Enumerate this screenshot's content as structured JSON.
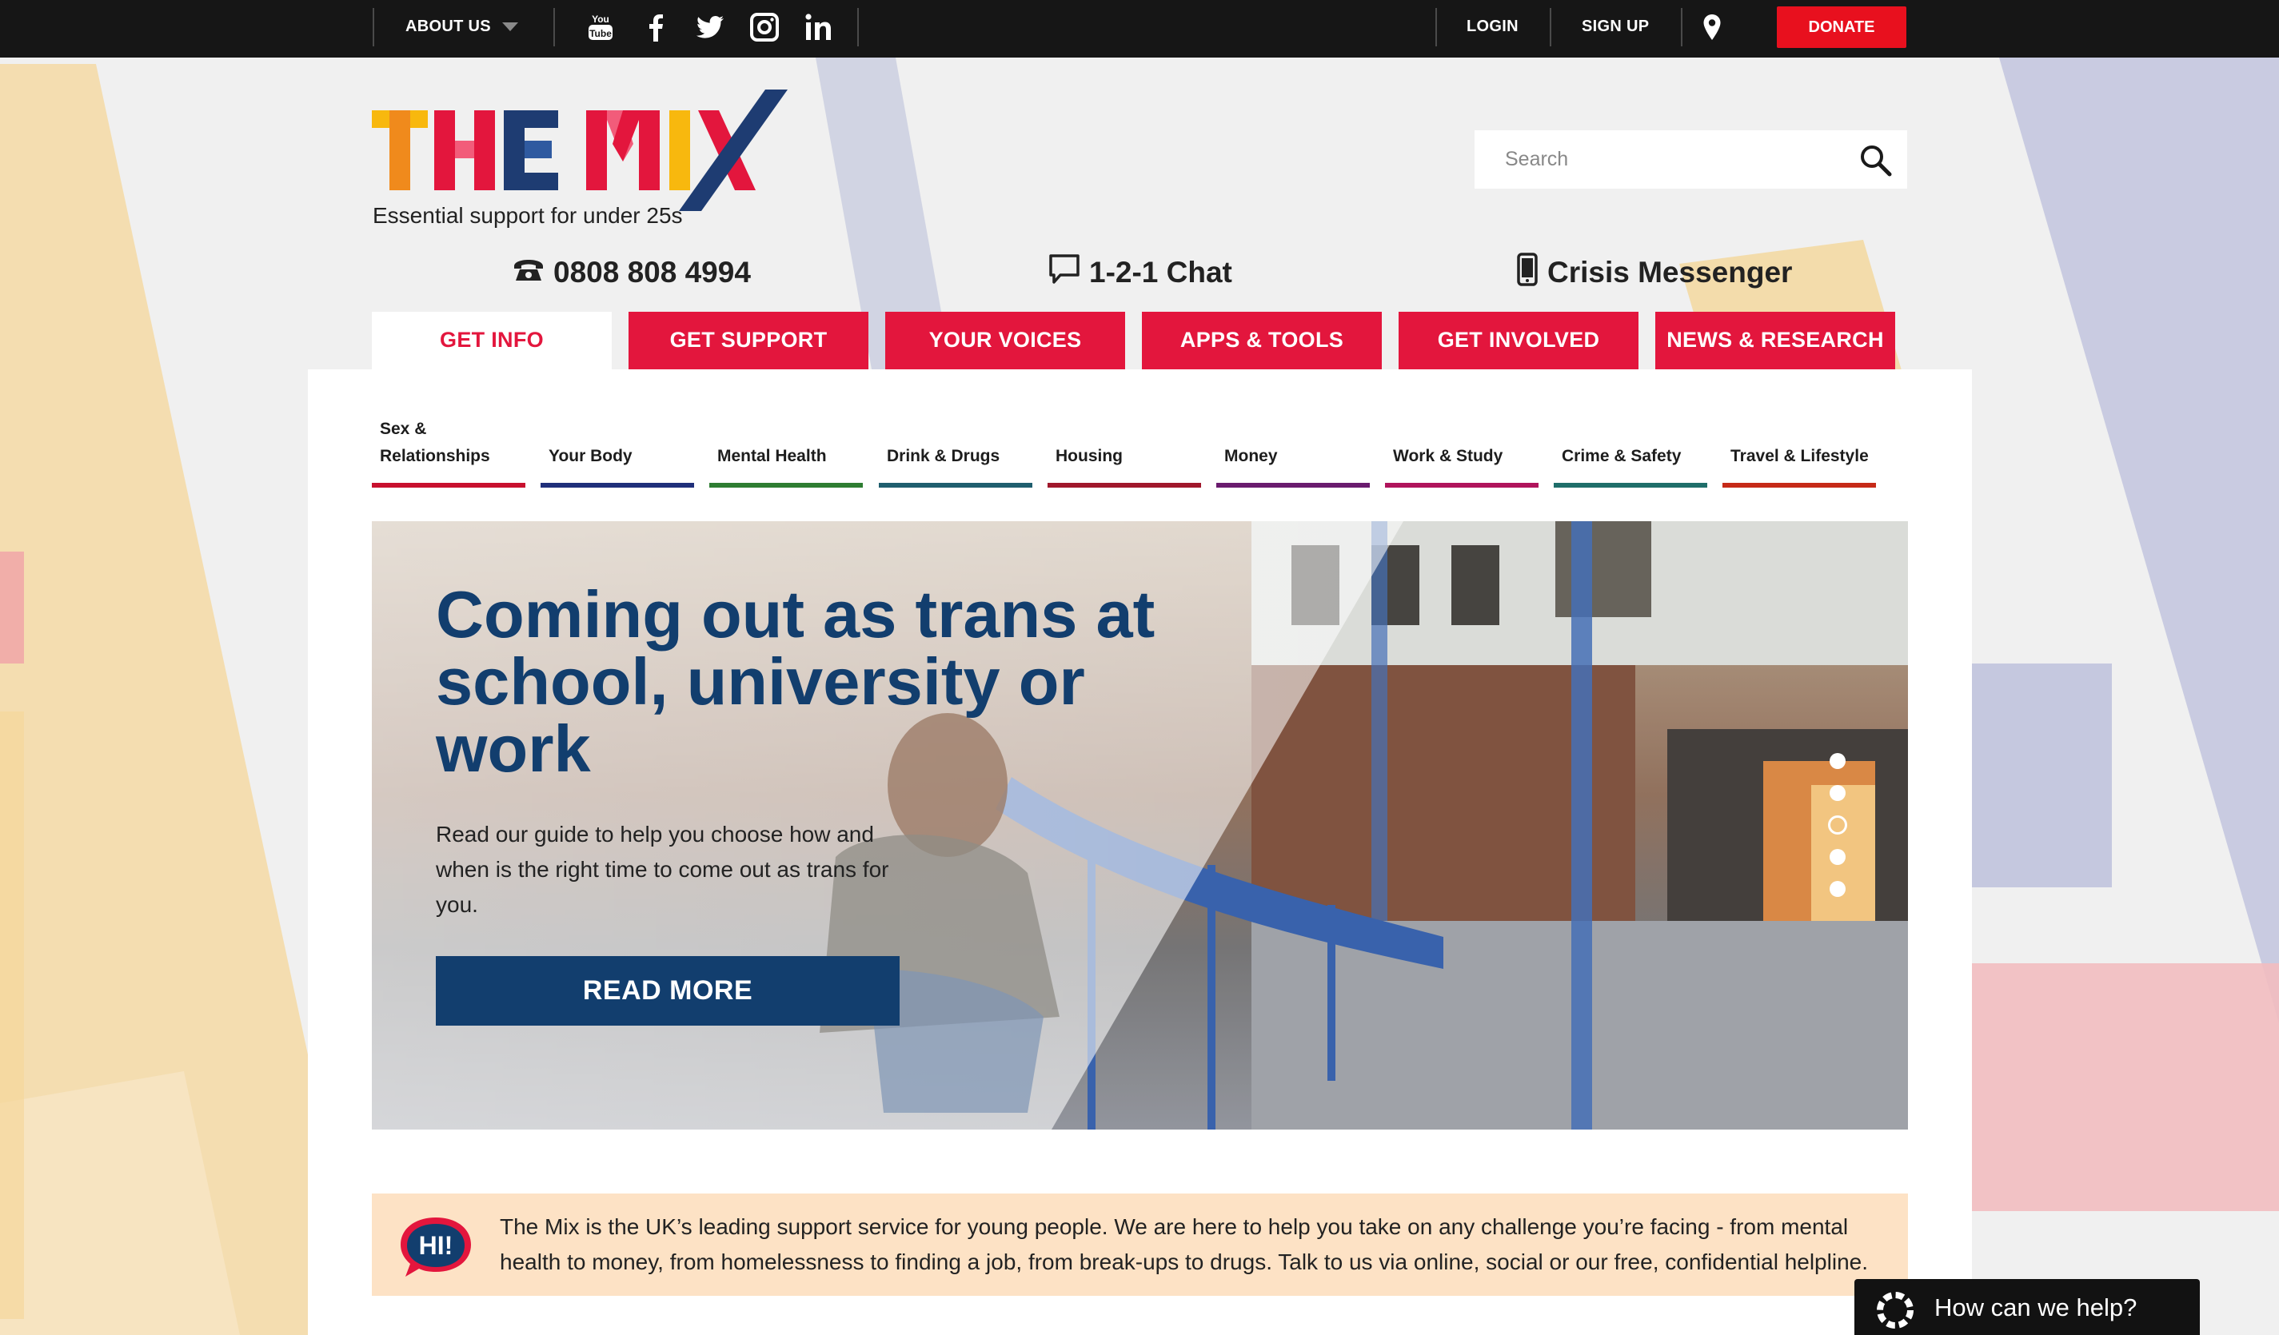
{
  "topbar": {
    "about_label": "ABOUT US",
    "social_icons": [
      "youtube-icon",
      "facebook-icon",
      "twitter-icon",
      "instagram-icon",
      "linkedin-icon"
    ],
    "login_label": "LOGIN",
    "signup_label": "SIGN UP",
    "location_icon": "map-pin-icon",
    "donate_label": "DONATE"
  },
  "header": {
    "logo_text": "THE MIX",
    "tagline": "Essential support for under 25s",
    "search_placeholder": "Search"
  },
  "contacts": {
    "phone": "0808 808 4994",
    "chat": "1-2-1 Chat",
    "crisis": "Crisis Messenger"
  },
  "nav": {
    "tabs": [
      {
        "label": "GET INFO"
      },
      {
        "label": "GET SUPPORT"
      },
      {
        "label": "YOUR VOICES"
      },
      {
        "label": "APPS & TOOLS"
      },
      {
        "label": "GET INVOLVED"
      },
      {
        "label": "NEWS & RESEARCH"
      }
    ]
  },
  "subcategories": [
    {
      "label": "Sex & Relationships",
      "color": "#c8102e"
    },
    {
      "label": "Your Body",
      "color": "#1f2f7a"
    },
    {
      "label": "Mental Health",
      "color": "#2e7d32"
    },
    {
      "label": "Drink & Drugs",
      "color": "#1f5e6e"
    },
    {
      "label": "Housing",
      "color": "#a0182c"
    },
    {
      "label": "Money",
      "color": "#6a1b6e"
    },
    {
      "label": "Work & Study",
      "color": "#b0145c"
    },
    {
      "label": "Crime & Safety",
      "color": "#1f6e6a"
    },
    {
      "label": "Travel & Lifestyle",
      "color": "#c62a18"
    }
  ],
  "hero": {
    "title": "Coming out as trans at school, university or work",
    "text": "Read our guide to help you choose how and when is the right time to come out as trans for you.",
    "button_label": "READ MORE",
    "slide_count": 5,
    "active_slide": 3
  },
  "intro": {
    "badge": "HI!",
    "text": "The Mix is the UK’s leading support service for young people. We are here to help you take on any challenge you’re facing - from mental health to money, from homelessness to finding a job, from break-ups to drugs. Talk to us via online, social or our free, confidential helpline."
  },
  "chat_widget": {
    "label": "How can we help?",
    "icon": "lifebuoy-icon"
  },
  "colors": {
    "brand_red": "#e3163d",
    "donate_red": "#e8101e",
    "navy": "#123e6e",
    "topbar": "#161616"
  }
}
